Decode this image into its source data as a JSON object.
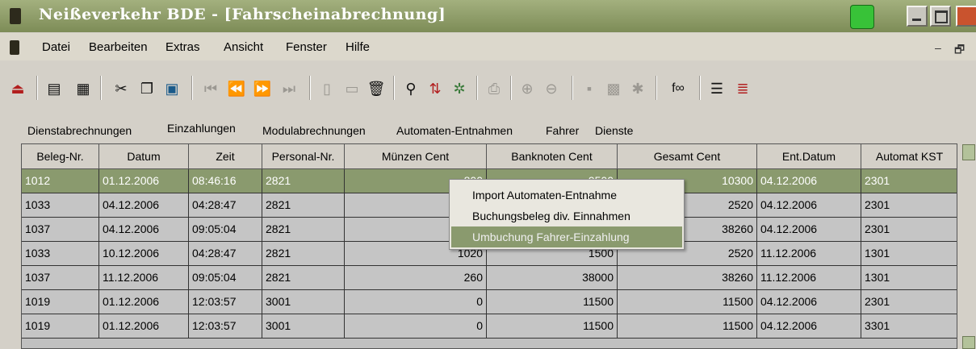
{
  "window": {
    "title": "Neißeverkehr BDE - [Fahrscheinabrechnung]",
    "colors": {
      "titlebar": "#8a9a6e",
      "selection": "#8a9a6e",
      "printer_icon": "#38c238",
      "close_button": "#c9532e"
    }
  },
  "menubar": {
    "items": [
      "Datei",
      "Bearbeiten",
      "Extras",
      "Ansicht",
      "Fenster",
      "Hilfe"
    ],
    "mdi_min": "–",
    "mdi_restore": "🗗"
  },
  "toolbar": {
    "icons": [
      "exit-icon",
      "print-preview-icon",
      "grid-icon",
      "cut-icon",
      "copy-icon",
      "paste-icon",
      "first-record-icon",
      "previous-record-icon",
      "next-record-icon",
      "last-record-icon",
      "new-record-icon",
      "edit-record-icon",
      "delete-icon",
      "search-icon",
      "sort-icon",
      "filter-icon",
      "print-icon",
      "zoom-in-icon",
      "zoom-out-icon",
      "save-icon",
      "fill-icon",
      "unpin-icon",
      "function-icon",
      "list-icon",
      "indent-icon"
    ],
    "function_label": "f∞"
  },
  "tabs": [
    {
      "label": "Dienstabrechnungen"
    },
    {
      "label": "Einzahlungen",
      "active": true
    },
    {
      "label": "Modulabrechnungen"
    },
    {
      "label": "Automaten-Entnahmen"
    },
    {
      "label": "Fahrer"
    },
    {
      "label": "Dienste"
    }
  ],
  "table": {
    "columns": [
      "Beleg-Nr.",
      "Datum",
      "Zeit",
      "Personal-Nr.",
      "Münzen Cent",
      "Banknoten Cent",
      "Gesamt Cent",
      "Ent.Datum",
      "Automat KST"
    ],
    "rows": [
      [
        "1012",
        "01.12.2006",
        "08:46:16",
        "2821",
        "800",
        "9500",
        "10300",
        "04.12.2006",
        "2301"
      ],
      [
        "1033",
        "04.12.2006",
        "04:28:47",
        "2821",
        "",
        "",
        "2520",
        "04.12.2006",
        "2301"
      ],
      [
        "1037",
        "04.12.2006",
        "09:05:04",
        "2821",
        "",
        "",
        "38260",
        "04.12.2006",
        "2301"
      ],
      [
        "1033",
        "10.12.2006",
        "04:28:47",
        "2821",
        "1020",
        "1500",
        "2520",
        "11.12.2006",
        "1301"
      ],
      [
        "1037",
        "11.12.2006",
        "09:05:04",
        "2821",
        "260",
        "38000",
        "38260",
        "11.12.2006",
        "1301"
      ],
      [
        "1019",
        "01.12.2006",
        "12:03:57",
        "3001",
        "0",
        "11500",
        "11500",
        "04.12.2006",
        "2301"
      ],
      [
        "1019",
        "01.12.2006",
        "12:03:57",
        "3001",
        "0",
        "11500",
        "11500",
        "04.12.2006",
        "3301"
      ]
    ],
    "selected_row": 0
  },
  "context_menu": {
    "items": [
      {
        "label": "Import Automaten-Entnahme"
      },
      {
        "label": "Buchungsbeleg div. Einnahmen"
      },
      {
        "label": "Umbuchung Fahrer-Einzahlung",
        "highlighted": true
      }
    ]
  }
}
